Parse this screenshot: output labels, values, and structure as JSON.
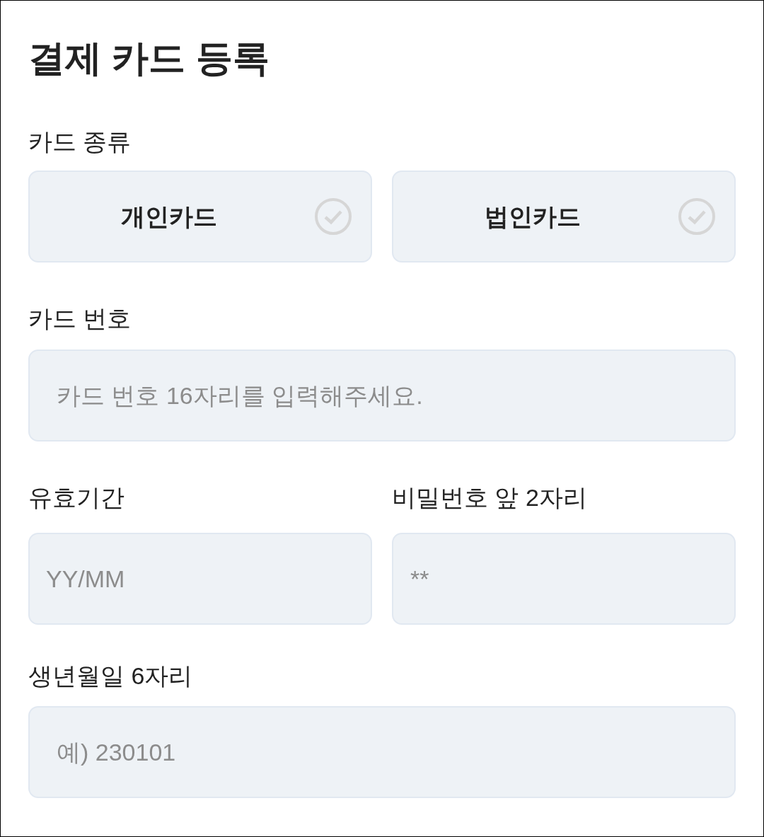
{
  "title": "결제 카드 등록",
  "card_type": {
    "label": "카드 종류",
    "options": [
      {
        "label": "개인카드",
        "selected": false
      },
      {
        "label": "법인카드",
        "selected": false
      }
    ]
  },
  "card_number": {
    "label": "카드 번호",
    "placeholder": "카드 번호 16자리를 입력해주세요."
  },
  "expiry": {
    "label": "유효기간",
    "placeholder": "YY/MM"
  },
  "password": {
    "label": "비밀번호 앞 2자리",
    "placeholder": "**"
  },
  "birthdate": {
    "label": "생년월일 6자리",
    "placeholder": "예) 230101"
  }
}
